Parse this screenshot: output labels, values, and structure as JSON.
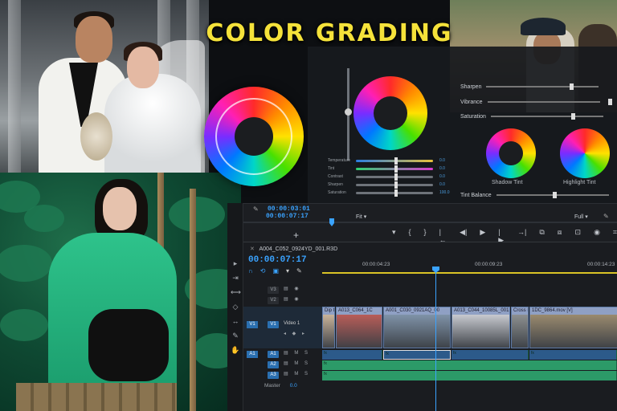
{
  "title": "COLOR GRADING",
  "colors": {
    "title": "#f5e23a",
    "accent": "#3aa3ff",
    "audio": "#2c9a68",
    "video": "#8fa0c4"
  },
  "lumetri": {
    "controls": [
      {
        "label": "Temperature",
        "value": "0.0",
        "track": "linear-gradient(90deg,#2a7de1,#e9c23a)"
      },
      {
        "label": "Tint",
        "value": "0.0",
        "track": "linear-gradient(90deg,#2fd36f,#d93ad0)"
      },
      {
        "label": "Contrast",
        "value": "0.0",
        "track": "#6e737a"
      },
      {
        "label": "Sharpen",
        "value": "0.0",
        "track": "#6e737a"
      },
      {
        "label": "Saturation",
        "value": "100.0",
        "track": "#6e737a"
      }
    ],
    "right_controls": [
      {
        "label": "Sharpen"
      },
      {
        "label": "Vibrance"
      },
      {
        "label": "Saturation"
      }
    ],
    "shadow_tint": "Shadow Tint",
    "highlight_tint": "Highlight Tint",
    "tint_balance": "Tint Balance"
  },
  "program_monitor": {
    "source_timecode": "00:00:03:01",
    "timecode": "00:00:07:17",
    "fit": "Fit",
    "resolution": "Full",
    "playhead_fraction": 0.23,
    "transport_icons": [
      "marker-icon",
      "in-point-icon",
      "out-point-icon",
      "go-to-in-icon",
      "step-back-icon",
      "play-icon",
      "step-forward-icon",
      "go-to-out-icon",
      "lift-icon",
      "extract-icon",
      "export-frame-icon",
      "camera-icon",
      "settings-icon"
    ],
    "transport_glyphs": [
      "▾",
      "{",
      "}",
      "|←",
      "◀|",
      "▶",
      "|▶",
      "→|",
      "⧉",
      "⧈",
      "⊡",
      "◉",
      "⌗"
    ]
  },
  "timeline": {
    "sequence_name": "A004_C052_0924YD_001.R3D",
    "timecode": "00:00:07:17",
    "ruler_marks": [
      "00:00:04:23",
      "00:00:09:23",
      "00:00:14:23"
    ],
    "tracks": {
      "video": [
        {
          "name": "V3"
        },
        {
          "name": "V2"
        },
        {
          "name": "V1",
          "label": "Video 1",
          "target": "V1"
        }
      ],
      "audio": [
        {
          "name": "A1",
          "target": "A1",
          "flags": "M S"
        },
        {
          "name": "A2",
          "flags": "M S"
        },
        {
          "name": "A3",
          "flags": "M S"
        }
      ],
      "master_label": "Master",
      "master_value": "0.0"
    },
    "clips": [
      {
        "name": "Dip to",
        "color": "#c9b39a"
      },
      {
        "name": "A013_C064_1C",
        "color": "#b85d58"
      },
      {
        "name": "A001_C030_0921AQ_00",
        "color": "#7f93a8"
      },
      {
        "name": "A013_C044_10085L_001.R",
        "color": "#c7c9cf"
      },
      {
        "name": "Cross D",
        "color": "#8d9090"
      },
      {
        "name": "1DC_9864.mov [V]",
        "color": "#9a8a6e"
      }
    ]
  }
}
